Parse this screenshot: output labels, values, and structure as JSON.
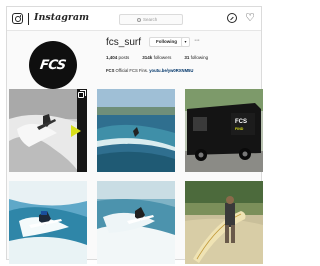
{
  "topbar": {
    "brand": "Instagram",
    "search_placeholder": "Search"
  },
  "icons": {
    "logo": "instagram-camera-icon",
    "search": "search-icon",
    "explore": "compass-icon",
    "activity": "heart-icon",
    "multi_post": "multiple-posts-icon"
  },
  "profile": {
    "username": "fcs_surf",
    "follow_label": "Following",
    "avatar_logo": "FCS",
    "stats": {
      "posts_count": "1,404",
      "posts_label": "posts",
      "followers_count": "314k",
      "followers_label": "followers",
      "following_count": "31",
      "following_label": "following"
    },
    "bio_name": "FCS",
    "bio_text": " Official FCS Fins. ",
    "bio_link": "youtu.be/yw0RXNM5U"
  },
  "colors": {
    "accent_yellow": "#d9df1a",
    "link_blue": "#003569",
    "avatar_bg": "#0f0f0f"
  }
}
